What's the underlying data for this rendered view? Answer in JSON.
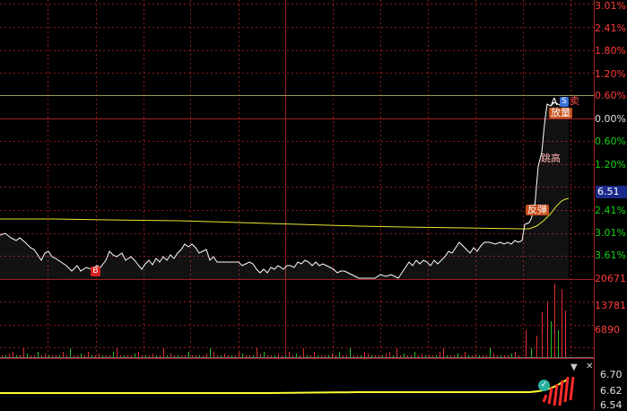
{
  "price_axis": [
    {
      "text": "3.01%",
      "color": "red"
    },
    {
      "text": "2.41%",
      "color": "red"
    },
    {
      "text": "1.80%",
      "color": "red"
    },
    {
      "text": "1.20%",
      "color": "red"
    },
    {
      "text": "0.60%",
      "color": "red"
    },
    {
      "text": "0.00%",
      "color": "white"
    },
    {
      "text": "0.60%",
      "color": "green"
    },
    {
      "text": "1.20%",
      "color": "green"
    },
    {
      "text": "2.41%",
      "color": "green"
    },
    {
      "text": "3.01%",
      "color": "green"
    },
    {
      "text": "3.61%",
      "color": "green"
    }
  ],
  "current_price": "6.51",
  "volume_axis": [
    "20671",
    "13781",
    "6890"
  ],
  "indicator_axis": [
    "6.70",
    "6.62",
    "6.54"
  ],
  "markers": {
    "buy": "B",
    "sell_flag_a": "A",
    "sell_flag_s": "S",
    "sell_text": "卖",
    "volume_surge": "放量",
    "gap_up": "跳高",
    "rebound": "反弹"
  },
  "controls": {
    "collapse": "▼",
    "close": "✕",
    "check": "✓"
  },
  "colors": {
    "background": "#000000",
    "grid": "#8b1a1a",
    "price_line": "#ffffff",
    "avg_line": "#e6e632",
    "volume_up": "#e03030",
    "volume_down": "#20c020",
    "indicator_line": "#ffff33"
  }
}
